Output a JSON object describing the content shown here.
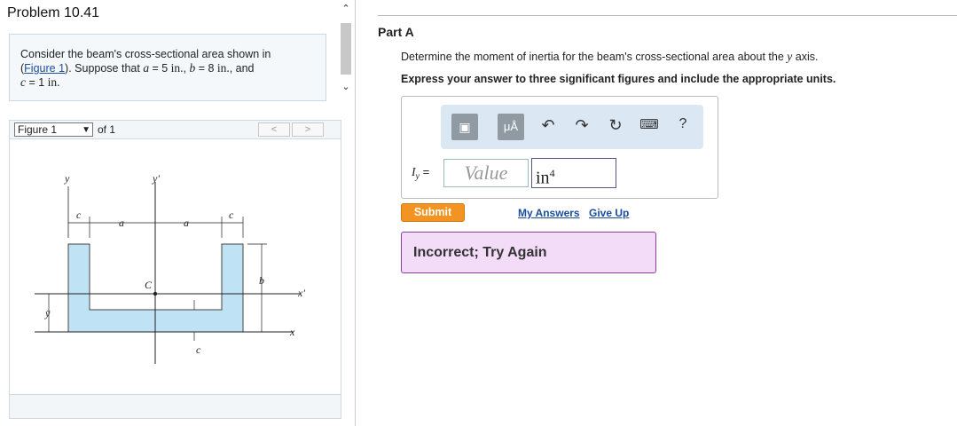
{
  "left": {
    "title": "Problem 10.41",
    "problem": {
      "t1": "Consider the beam's cross-sectional area shown in",
      "link": "Figure 1",
      "t2": ". Suppose that",
      "a_var": "a",
      "a_eq": " = 5",
      "a_unit": " in.",
      "b_var": "b",
      "b_eq": " = 8",
      "b_unit": " in.",
      "and": ", and",
      "c_var": "c",
      "c_eq": " = 1",
      "c_unit": " in."
    },
    "figure": {
      "select_value": "Figure 1",
      "of_label": "of 1",
      "prev": "<",
      "next": ">",
      "labels": {
        "y": "y",
        "yp": "y'",
        "c": "c",
        "a": "a",
        "C": "C",
        "b": "b",
        "xp": "x'",
        "x": "x",
        "ybar": "ȳ"
      }
    }
  },
  "right": {
    "part": "Part A",
    "question": "Determine the moment of inertia for the beam's cross-sectional area about the",
    "question_var": "y",
    "question_end": "axis.",
    "instruction": "Express your answer to three significant figures and include the appropriate units.",
    "toolbar": {
      "units_btn": "μÅ",
      "help": "?"
    },
    "answer_label_var": "I",
    "answer_label_sub": "y",
    "answer_label_eq": " =",
    "value_placeholder": "Value",
    "unit_value": "in",
    "unit_exp": "4",
    "submit": "Submit",
    "my_answers": "My Answers",
    "give_up": "Give Up",
    "feedback": "Incorrect; Try Again",
    "colors": {
      "submit": "#f39321",
      "feedback_bg": "#f2dcf7",
      "feedback_border": "#8c3c9c",
      "shape_fill": "#bfe2f5"
    }
  }
}
